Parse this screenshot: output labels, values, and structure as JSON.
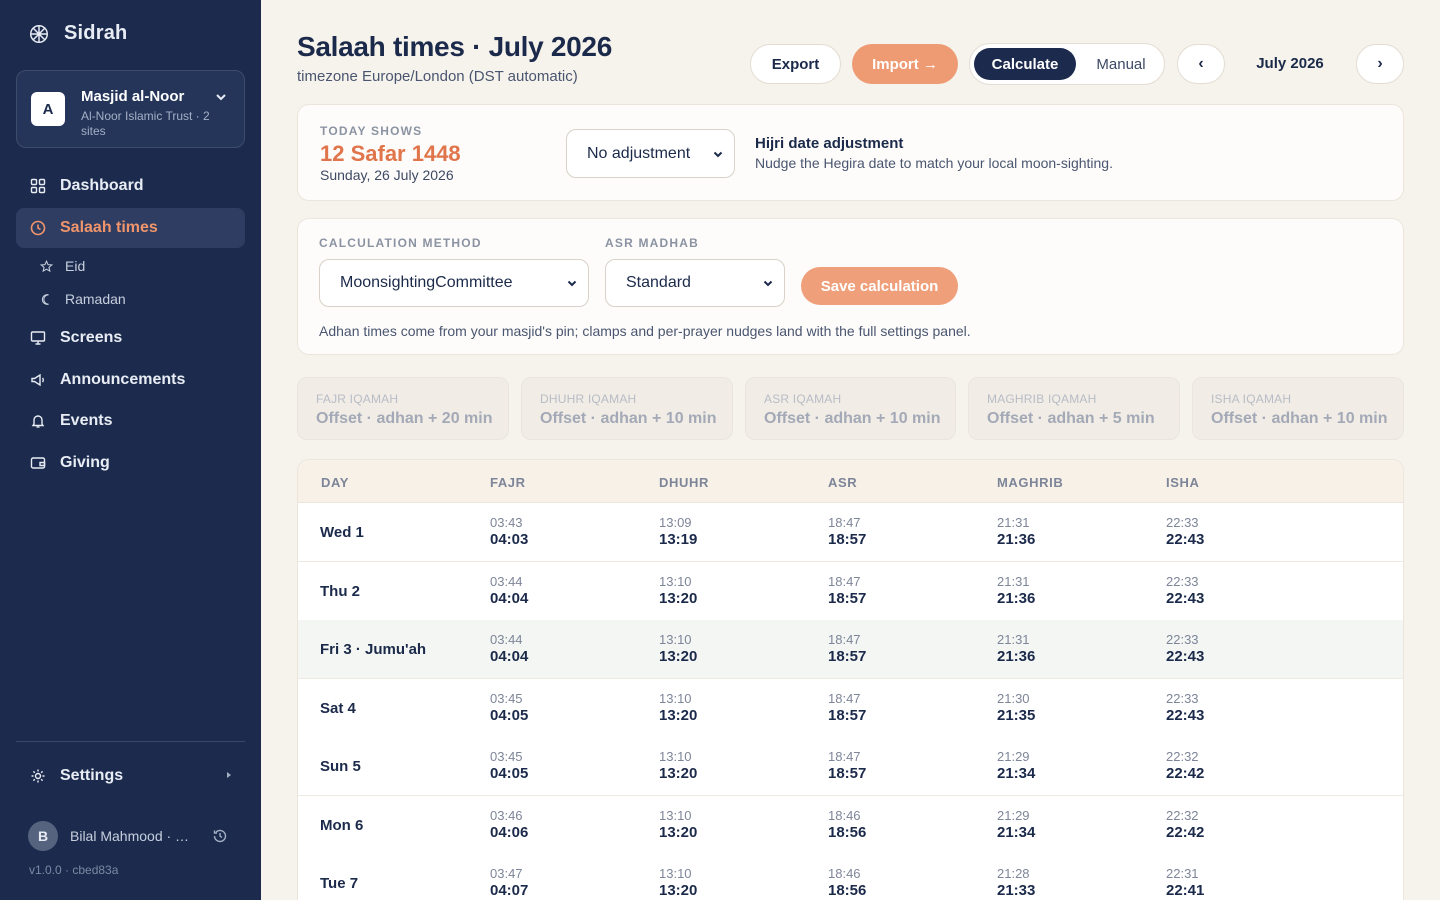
{
  "brand": {
    "name": "Sidrah"
  },
  "org": {
    "initial": "A",
    "name": "Masjid al-Noor",
    "sub": "Al-Noor Islamic Trust · 2 sites"
  },
  "nav": {
    "dashboard": "Dashboard",
    "salaah": "Salaah times",
    "eid": "Eid",
    "ramadan": "Ramadan",
    "screens": "Screens",
    "announcements": "Announcements",
    "events": "Events",
    "giving": "Giving",
    "settings": "Settings"
  },
  "user": {
    "initial": "B",
    "name": "Bilal Mahmood · a..."
  },
  "version": "v1.0.0 · cbed83a",
  "header": {
    "title": "Salaah times · July 2026",
    "subtitle": "timezone Europe/London (DST automatic)",
    "export": "Export",
    "import": "Import →",
    "calculate": "Calculate",
    "manual": "Manual",
    "prev": "‹",
    "next": "›",
    "month": "July 2026"
  },
  "hijri": {
    "eyebrow": "TODAY SHOWS",
    "date": "12 Safar 1448",
    "gregorian": "Sunday, 26 July 2026",
    "adjustment": "No adjustment",
    "adj_title": "Hijri date adjustment",
    "adj_desc": "Nudge the Hegira date to match your local moon-sighting."
  },
  "calc": {
    "method_label": "CALCULATION METHOD",
    "method": "MoonsightingCommittee",
    "asr_label": "ASR MADHAB",
    "asr": "Standard",
    "save": "Save calculation",
    "note": "Adhan times come from your masjid's pin; clamps and per-prayer nudges land with the full settings panel."
  },
  "iqamah": [
    {
      "label": "FAJR IQAMAH",
      "value": "Offset · adhan + 20 min"
    },
    {
      "label": "DHUHR IQAMAH",
      "value": "Offset · adhan + 10 min"
    },
    {
      "label": "ASR IQAMAH",
      "value": "Offset · adhan + 10 min"
    },
    {
      "label": "MAGHRIB IQAMAH",
      "value": "Offset · adhan + 5 min"
    },
    {
      "label": "ISHA IQAMAH",
      "value": "Offset · adhan + 10 min"
    }
  ],
  "table": {
    "headers": [
      "DAY",
      "FAJR",
      "DHUHR",
      "ASR",
      "MAGHRIB",
      "ISHA"
    ],
    "rows": [
      {
        "day": "Wed 1",
        "fajr": [
          "03:43",
          "04:03"
        ],
        "dhuhr": [
          "13:09",
          "13:19"
        ],
        "asr": [
          "18:47",
          "18:57"
        ],
        "maghrib": [
          "21:31",
          "21:36"
        ],
        "isha": [
          "22:33",
          "22:43"
        ]
      },
      {
        "day": "Thu 2",
        "fajr": [
          "03:44",
          "04:04"
        ],
        "dhuhr": [
          "13:10",
          "13:20"
        ],
        "asr": [
          "18:47",
          "18:57"
        ],
        "maghrib": [
          "21:31",
          "21:36"
        ],
        "isha": [
          "22:33",
          "22:43"
        ]
      },
      {
        "day": "Fri 3 · Jumu'ah",
        "fajr": [
          "03:44",
          "04:04"
        ],
        "dhuhr": [
          "13:10",
          "13:20"
        ],
        "asr": [
          "18:47",
          "18:57"
        ],
        "maghrib": [
          "21:31",
          "21:36"
        ],
        "isha": [
          "22:33",
          "22:43"
        ]
      },
      {
        "day": "Sat 4",
        "fajr": [
          "03:45",
          "04:05"
        ],
        "dhuhr": [
          "13:10",
          "13:20"
        ],
        "asr": [
          "18:47",
          "18:57"
        ],
        "maghrib": [
          "21:30",
          "21:35"
        ],
        "isha": [
          "22:33",
          "22:43"
        ]
      },
      {
        "day": "Sun 5",
        "fajr": [
          "03:45",
          "04:05"
        ],
        "dhuhr": [
          "13:10",
          "13:20"
        ],
        "asr": [
          "18:47",
          "18:57"
        ],
        "maghrib": [
          "21:29",
          "21:34"
        ],
        "isha": [
          "22:32",
          "22:42"
        ]
      },
      {
        "day": "Mon 6",
        "fajr": [
          "03:46",
          "04:06"
        ],
        "dhuhr": [
          "13:10",
          "13:20"
        ],
        "asr": [
          "18:46",
          "18:56"
        ],
        "maghrib": [
          "21:29",
          "21:34"
        ],
        "isha": [
          "22:32",
          "22:42"
        ]
      },
      {
        "day": "Tue 7",
        "fajr": [
          "03:47",
          "04:07"
        ],
        "dhuhr": [
          "13:10",
          "13:20"
        ],
        "asr": [
          "18:46",
          "18:56"
        ],
        "maghrib": [
          "21:28",
          "21:33"
        ],
        "isha": [
          "22:31",
          "22:41"
        ]
      }
    ]
  },
  "colors": {
    "sidebar": "#1c2b4d",
    "accent": "#e0744a",
    "background": "#f6f2ec"
  }
}
